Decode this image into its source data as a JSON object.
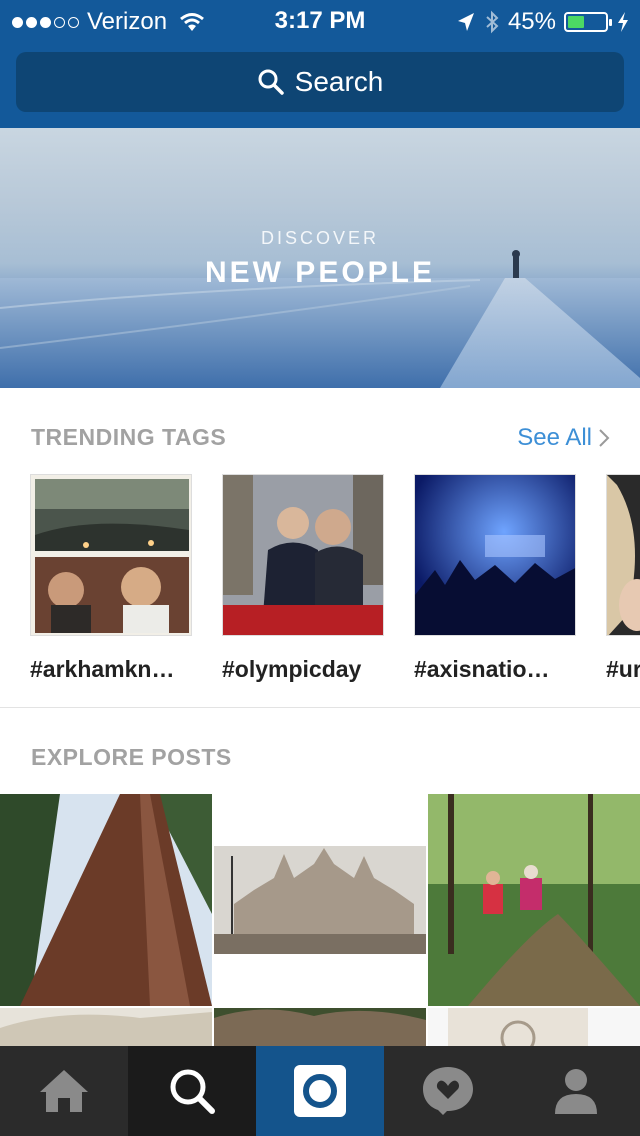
{
  "status_bar": {
    "carrier": "Verizon",
    "time": "3:17 PM",
    "battery_percent": "45%",
    "battery_level": 0.45,
    "battery_color": "#4cd964"
  },
  "search": {
    "placeholder": "Search"
  },
  "hero": {
    "subtitle": "DISCOVER",
    "title": "NEW PEOPLE"
  },
  "trending": {
    "header": "TRENDING TAGS",
    "see_all": "See All",
    "tags": [
      {
        "label": "#arkhamkn…",
        "icon": "tag-thumbnail"
      },
      {
        "label": "#olympicday",
        "icon": "tag-thumbnail"
      },
      {
        "label": "#axisnatio…",
        "icon": "tag-thumbnail"
      },
      {
        "label": "#ur",
        "icon": "tag-thumbnail"
      }
    ]
  },
  "explore": {
    "header": "EXPLORE POSTS"
  },
  "tabbar": {
    "items": [
      "home-icon",
      "search-icon",
      "camera-icon",
      "activity-icon",
      "profile-icon"
    ],
    "active": "search-icon"
  },
  "colors": {
    "header_blue": "#13599a",
    "search_field": "#0e4574",
    "link_blue": "#3d8fd6",
    "tabbar": "#2b2b2b",
    "camera_tab": "#14548c"
  }
}
